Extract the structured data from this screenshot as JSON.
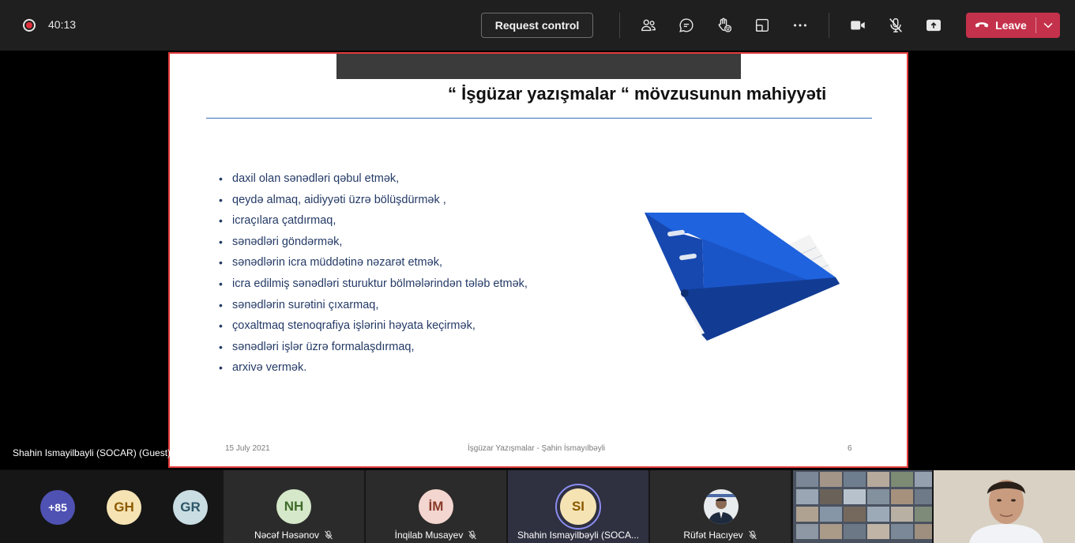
{
  "topbar": {
    "timer": "40:13",
    "request_control_label": "Request control",
    "leave_label": "Leave",
    "icons": [
      "people-icon",
      "chat-icon",
      "reactions-icon",
      "rooms-icon",
      "more-icon",
      "camera-icon",
      "mic-off-icon",
      "share-icon"
    ]
  },
  "presenter": {
    "label": "Shahin Ismayilbayli (SOCAR) (Guest)"
  },
  "slide": {
    "title": "“ İşgüzar yazışmalar “ mövzusunun mahiyyəti",
    "bullets": [
      "daxil olan sənədləri qəbul etmək,",
      "qeydə almaq, aidiyyəti üzrə bölüşdürmək ,",
      "icraçılara çatdırmaq,",
      "sənədləri göndərmək,",
      "sənədlərin icra müddətinə nəzarət etmək,",
      "icra edilmiş sənədləri sturuktur bölmələrindən tələb etmək,",
      "sənədlərin surətini çıxarmaq,",
      "çoxaltmaq stenoqrafiya işlərini həyata keçirmək,",
      "sənədləri işlər üzrə formalaşdırmaq,",
      "arxivə vermək."
    ],
    "footer_date": "15 July 2021",
    "footer_center": "İşgüzar Yazışmalar - Şahin İsmayılbəyli",
    "page_number": "6"
  },
  "participants": {
    "overflow_count": "+85",
    "avatars": [
      {
        "initials": "GH",
        "bg": "#f6e3b4",
        "fg": "#8a5a00"
      },
      {
        "initials": "GR",
        "bg": "#c9dde3",
        "fg": "#2d5566"
      }
    ],
    "tiles": [
      {
        "initials": "NH",
        "name": "Nəcəf Həsənov",
        "bg": "#d5e8c9",
        "fg": "#3f6b2a"
      },
      {
        "initials": "İM",
        "name": "İnqilab Musayev",
        "bg": "#f3d6cf",
        "fg": "#8a3a2a"
      },
      {
        "initials": "SI",
        "name": "Shahin Ismayilbəyli (SOCA...",
        "bg": "#f6e3b4",
        "fg": "#8a5a00"
      },
      {
        "name": "Rüfət Hacıyev"
      }
    ]
  },
  "colors": {
    "leave": "#c4314b",
    "slide_border": "#e33b3b",
    "binder_blue": "#1a55c8",
    "bullet_text": "#243a66"
  }
}
